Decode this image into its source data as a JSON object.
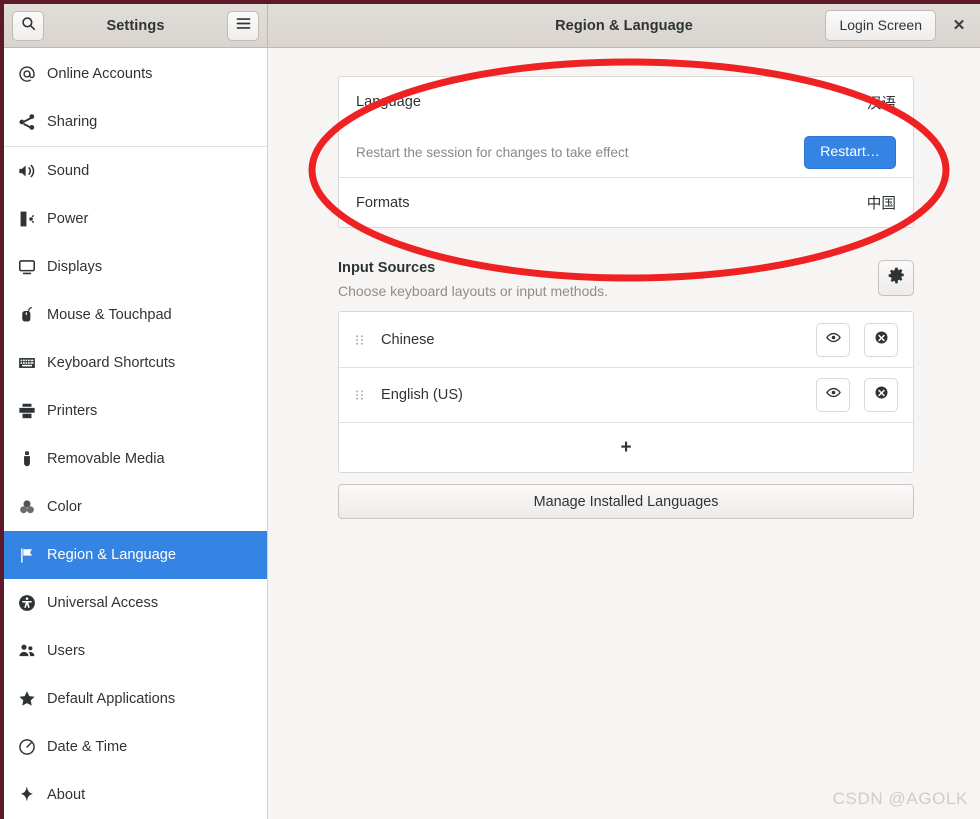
{
  "window": {
    "border_color": "#5c1a28",
    "accent_color": "#3584e4",
    "annotation_color": "#ee2222"
  },
  "header": {
    "app_title": "Settings",
    "panel_title": "Region & Language",
    "search_icon": "search-icon",
    "menu_icon": "hamburger-menu-icon",
    "login_screen_label": "Login Screen",
    "close_label": "✕"
  },
  "sidebar": {
    "items": [
      {
        "label": "Online Accounts",
        "icon": "at-sign-icon",
        "selected": false,
        "sep_after": false
      },
      {
        "label": "Sharing",
        "icon": "share-icon",
        "selected": false,
        "sep_after": true
      },
      {
        "label": "Sound",
        "icon": "speaker-icon",
        "selected": false,
        "sep_after": false
      },
      {
        "label": "Power",
        "icon": "battery-icon",
        "selected": false,
        "sep_after": false
      },
      {
        "label": "Displays",
        "icon": "monitor-icon",
        "selected": false,
        "sep_after": false
      },
      {
        "label": "Mouse & Touchpad",
        "icon": "mouse-icon",
        "selected": false,
        "sep_after": false
      },
      {
        "label": "Keyboard Shortcuts",
        "icon": "keyboard-icon",
        "selected": false,
        "sep_after": false
      },
      {
        "label": "Printers",
        "icon": "printer-icon",
        "selected": false,
        "sep_after": false
      },
      {
        "label": "Removable Media",
        "icon": "usb-drive-icon",
        "selected": false,
        "sep_after": false
      },
      {
        "label": "Color",
        "icon": "color-circles-icon",
        "selected": false,
        "sep_after": false
      },
      {
        "label": "Region & Language",
        "icon": "flag-icon",
        "selected": true,
        "sep_after": false
      },
      {
        "label": "Universal Access",
        "icon": "accessibility-icon",
        "selected": false,
        "sep_after": false
      },
      {
        "label": "Users",
        "icon": "people-icon",
        "selected": false,
        "sep_after": false
      },
      {
        "label": "Default Applications",
        "icon": "star-icon",
        "selected": false,
        "sep_after": false
      },
      {
        "label": "Date & Time",
        "icon": "clock-icon",
        "selected": false,
        "sep_after": false
      },
      {
        "label": "About",
        "icon": "sparkle-icon",
        "selected": false,
        "sep_after": false
      }
    ]
  },
  "main": {
    "language_row": {
      "label": "Language",
      "value": "汉语"
    },
    "restart_row": {
      "note": "Restart the session for changes to take effect",
      "button_label": "Restart…"
    },
    "formats_row": {
      "label": "Formats",
      "value": "中国"
    },
    "input_sources": {
      "title": "Input Sources",
      "subtitle": "Choose keyboard layouts or input methods.",
      "settings_icon": "gear-icon",
      "items": [
        {
          "name": "Chinese",
          "drag_icon": "drag-handle-icon",
          "preview_icon": "eye-icon",
          "remove_icon": "remove-circle-icon"
        },
        {
          "name": "English (US)",
          "drag_icon": "drag-handle-icon",
          "preview_icon": "eye-icon",
          "remove_icon": "remove-circle-icon"
        }
      ],
      "add_label": "+"
    },
    "manage_button_label": "Manage Installed Languages"
  },
  "watermark": {
    "text": "CSDN @AGOLK"
  }
}
